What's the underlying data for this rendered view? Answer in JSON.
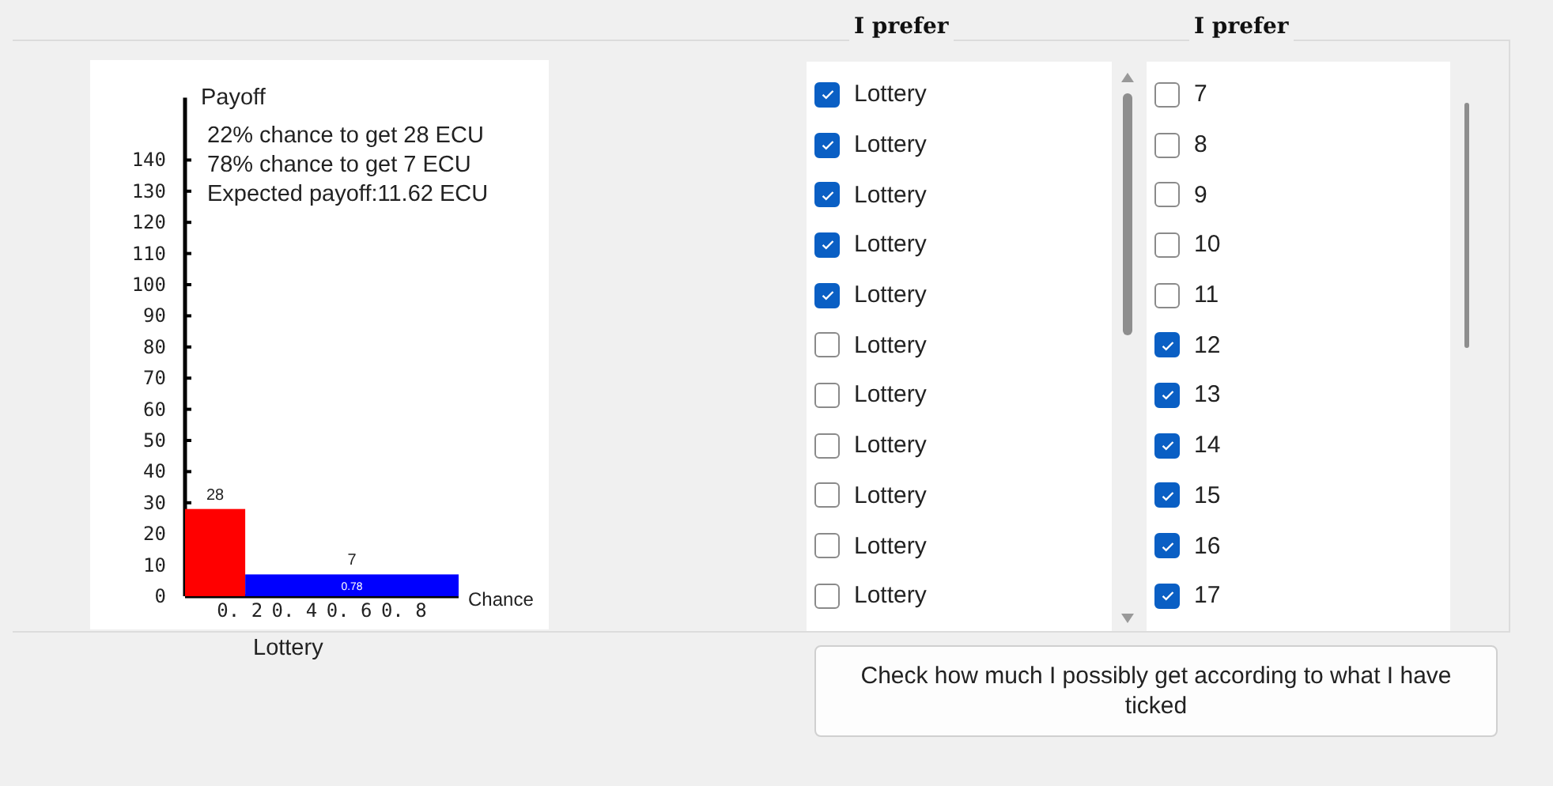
{
  "chart_panel": {
    "x_tick_labels": [
      "0. 2",
      "0. 4",
      "0. 6",
      "0. 8"
    ],
    "info_lines": [
      "22% chance to get 28 ECU",
      "78% chance to get 7 ECU",
      "Expected payoff:11.62 ECU"
    ],
    "chart_data": {
      "type": "bar",
      "xlabel": "Chance",
      "ylabel": "Payoff",
      "x": [
        0.22,
        1.0
      ],
      "series": [
        {
          "color": "#ff0000",
          "values": [
            28,
            null
          ]
        },
        {
          "color": "#0000ff",
          "values": [
            null,
            7
          ]
        }
      ],
      "xlim": [
        0,
        1
      ],
      "ylim": [
        0,
        160
      ],
      "xticks": [
        0.2,
        0.4,
        0.6,
        0.8
      ],
      "yticks": [
        0,
        10,
        20,
        30,
        40,
        50,
        60,
        70,
        80,
        90,
        100,
        110,
        120,
        130,
        140
      ],
      "data_labels": true,
      "annotations": [
        "0.78"
      ]
    }
  },
  "chart_caption": "Lottery",
  "lists": [
    {
      "heading": "I prefer",
      "items": [
        {
          "label": "Lottery",
          "checked": true
        },
        {
          "label": "Lottery",
          "checked": true
        },
        {
          "label": "Lottery",
          "checked": true
        },
        {
          "label": "Lottery",
          "checked": true
        },
        {
          "label": "Lottery",
          "checked": true
        },
        {
          "label": "Lottery",
          "checked": false
        },
        {
          "label": "Lottery",
          "checked": false
        },
        {
          "label": "Lottery",
          "checked": false
        },
        {
          "label": "Lottery",
          "checked": false
        },
        {
          "label": "Lottery",
          "checked": false
        },
        {
          "label": "Lottery",
          "checked": false
        }
      ]
    },
    {
      "heading": "I prefer",
      "items": [
        {
          "label": "7",
          "checked": false
        },
        {
          "label": "8",
          "checked": false
        },
        {
          "label": "9",
          "checked": false
        },
        {
          "label": "10",
          "checked": false
        },
        {
          "label": "11",
          "checked": false
        },
        {
          "label": "12",
          "checked": true
        },
        {
          "label": "13",
          "checked": true
        },
        {
          "label": "14",
          "checked": true
        },
        {
          "label": "15",
          "checked": true
        },
        {
          "label": "16",
          "checked": true
        },
        {
          "label": "17",
          "checked": true
        }
      ]
    }
  ],
  "button": "Check how much I possibly get according to what I have ticked"
}
